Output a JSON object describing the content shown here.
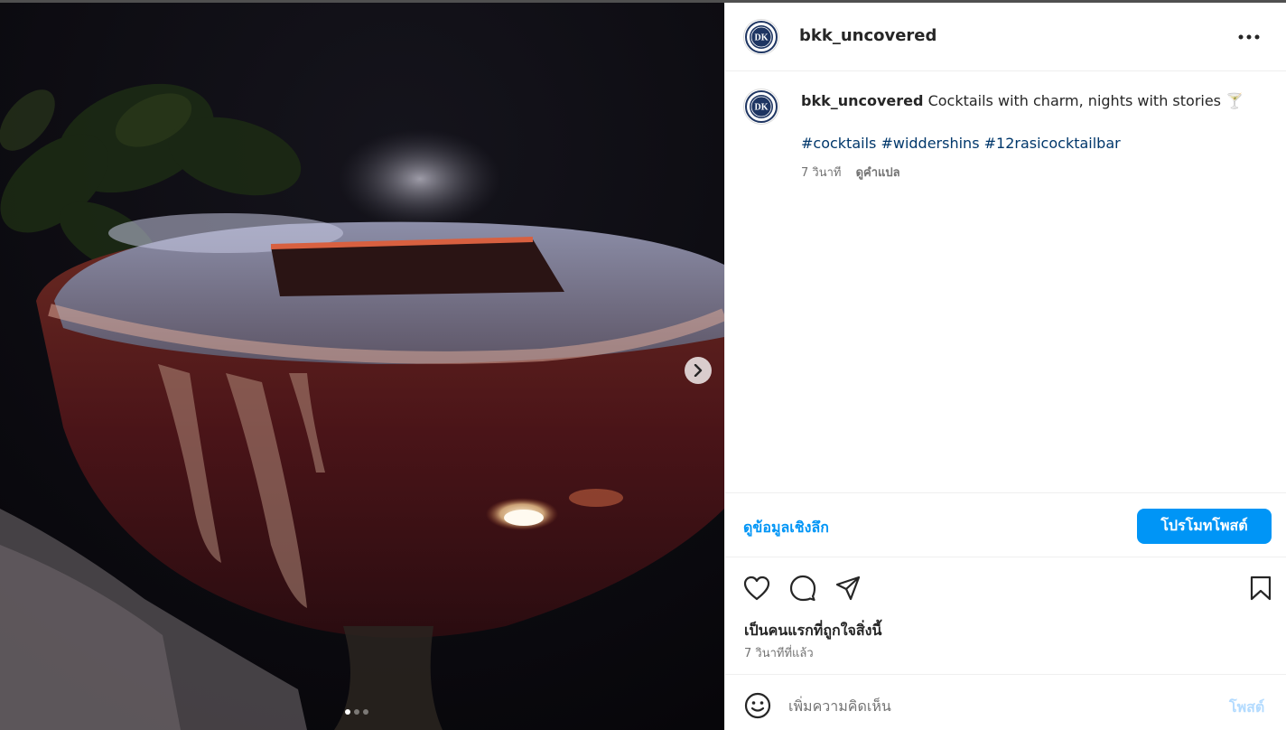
{
  "colors": {
    "accent": "#0095f6",
    "hashtag": "#00376b",
    "secondary_text": "#737373",
    "primary_text": "#262626",
    "post_disabled": "#b3dbff",
    "divider": "#efefef"
  },
  "media": {
    "carousel_position": 1,
    "carousel_count": 3,
    "next_icon": "chevron-right-icon"
  },
  "header": {
    "username": "bkk_uncovered",
    "avatar_letters": "DK",
    "more_icon": "more-horizontal-icon"
  },
  "caption": {
    "username": "bkk_uncovered",
    "text": "Cocktails with charm, nights with stories",
    "emoji": "🍸",
    "hashtags": [
      "#cocktails",
      "#widdershins",
      "#12rasicocktailbar"
    ],
    "time": "7 วินาที",
    "translate_label": "ดูคำแปล"
  },
  "insights": {
    "view_insights_label": "ดูข้อมูลเชิงลึก",
    "promote_label": "โปรโมทโพสต์"
  },
  "actions": {
    "icons": [
      "heart-icon",
      "comment-icon",
      "share-icon",
      "bookmark-icon"
    ]
  },
  "likes": {
    "text": "เป็นคนแรกที่ถูกใจสิ่งนี้",
    "time_ago": "7 วินาทีที่แล้ว"
  },
  "comment": {
    "placeholder": "เพิ่มความคิดเห็น",
    "post_label": "โพสต์",
    "emoji_icon": "emoji-icon"
  }
}
